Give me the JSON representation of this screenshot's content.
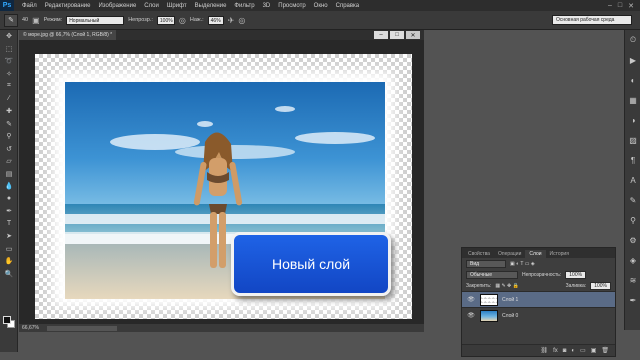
{
  "app": {
    "logo": "Ps"
  },
  "menu": [
    "Файл",
    "Редактирование",
    "Изображение",
    "Слои",
    "Шрифт",
    "Выделение",
    "Фильтр",
    "3D",
    "Просмотр",
    "Окно",
    "Справка"
  ],
  "window_controls": [
    "–",
    "□",
    "✕"
  ],
  "options": {
    "mode_label": "Режим:",
    "mode_value": "Нормальный",
    "opacity_label": "Непрозр.:",
    "opacity_value": "100%",
    "flow_label": "Наж.:",
    "flow_value": "46%",
    "brush_size": "40",
    "workspace": "Основная рабочая среда"
  },
  "document": {
    "tab_title": "© море.jpg @ 66,7% (Слой 1, RGB/8) *",
    "zoom": "66,67%",
    "overlay_text": "Новый слой"
  },
  "layers_panel": {
    "tabs": [
      "Свойства",
      "Операции",
      "Слои",
      "История"
    ],
    "active_tab": "Слои",
    "filter_kind": "Вид",
    "blend_mode": "Обычные",
    "opacity_label": "Непрозрачность:",
    "opacity_value": "100%",
    "lock_label": "Закрепить:",
    "fill_label": "Заливка:",
    "fill_value": "100%",
    "layers": [
      {
        "name": "Слой 1",
        "selected": true,
        "thumb": "checker"
      },
      {
        "name": "Слой 0",
        "selected": false,
        "thumb": "photo"
      }
    ]
  },
  "icons": {
    "tools": [
      "move-icon",
      "marquee-icon",
      "lasso-icon",
      "quick-select-icon",
      "crop-icon",
      "eyedropper-icon",
      "healing-icon",
      "brush-icon",
      "clone-stamp-icon",
      "history-brush-icon",
      "eraser-icon",
      "gradient-icon",
      "blur-icon",
      "dodge-icon",
      "pen-icon",
      "type-icon",
      "path-select-icon",
      "shape-icon",
      "hand-icon",
      "zoom-icon"
    ],
    "dock": [
      "history-icon",
      "actions-icon",
      "color-icon",
      "swatches-icon",
      "adjustments-icon",
      "styles-icon",
      "paragraph-icon",
      "character-icon",
      "brush-presets-icon",
      "clone-source-icon",
      "tool-presets-icon",
      "layers-icon",
      "channels-icon",
      "paths-icon"
    ]
  }
}
